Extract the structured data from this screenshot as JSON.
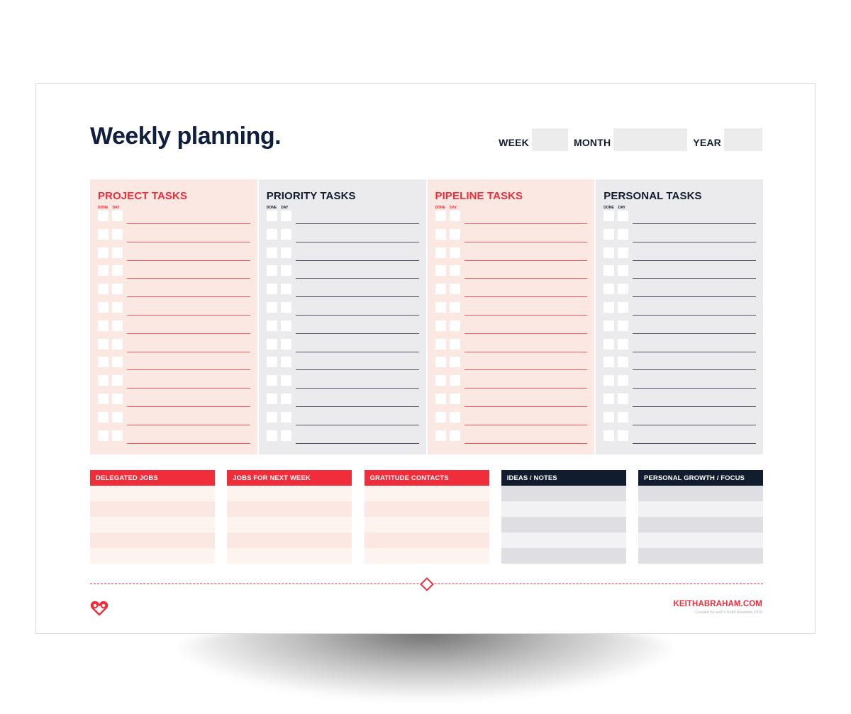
{
  "page": {
    "title": "Weekly planning."
  },
  "date_fields": {
    "week_label": "WEEK",
    "week_value": "",
    "month_label": "MONTH",
    "month_value": "",
    "year_label": "YEAR",
    "year_value": ""
  },
  "task_columns": [
    {
      "title": "PROJECT TASKS",
      "done_label": "DONE",
      "day_label": "DAY",
      "theme": "red",
      "row_count": 13
    },
    {
      "title": "PRIORITY TASKS",
      "done_label": "DONE",
      "day_label": "DAY",
      "theme": "grey",
      "row_count": 13
    },
    {
      "title": "PIPELINE TASKS",
      "done_label": "DONE",
      "day_label": "DAY",
      "theme": "red",
      "row_count": 13
    },
    {
      "title": "PERSONAL TASKS",
      "done_label": "DONE",
      "day_label": "DAY",
      "theme": "grey",
      "row_count": 13
    }
  ],
  "note_boxes": [
    {
      "title": "DELEGATED JOBS",
      "theme": "red",
      "row_count": 5
    },
    {
      "title": "JOBS FOR NEXT WEEK",
      "theme": "red",
      "row_count": 5
    },
    {
      "title": "GRATITUDE CONTACTS",
      "theme": "red",
      "row_count": 5
    },
    {
      "title": "IDEAS / NOTES",
      "theme": "dark",
      "row_count": 5
    },
    {
      "title": "PERSONAL GROWTH / FOCUS",
      "theme": "dark",
      "row_count": 5
    }
  ],
  "footer": {
    "logo_icon": "double-heart-logo-icon",
    "divider_icon": "diamond-icon",
    "site": "KEITHABRAHAM.COM",
    "credit": "Created by and © Keith Abraham 2019"
  },
  "colors": {
    "accent_red": "#ef2d3b",
    "navy": "#111c2e",
    "title_navy": "#0f1f3d",
    "pink_panel": "#fce8e2",
    "grey_panel": "#ebebee"
  }
}
